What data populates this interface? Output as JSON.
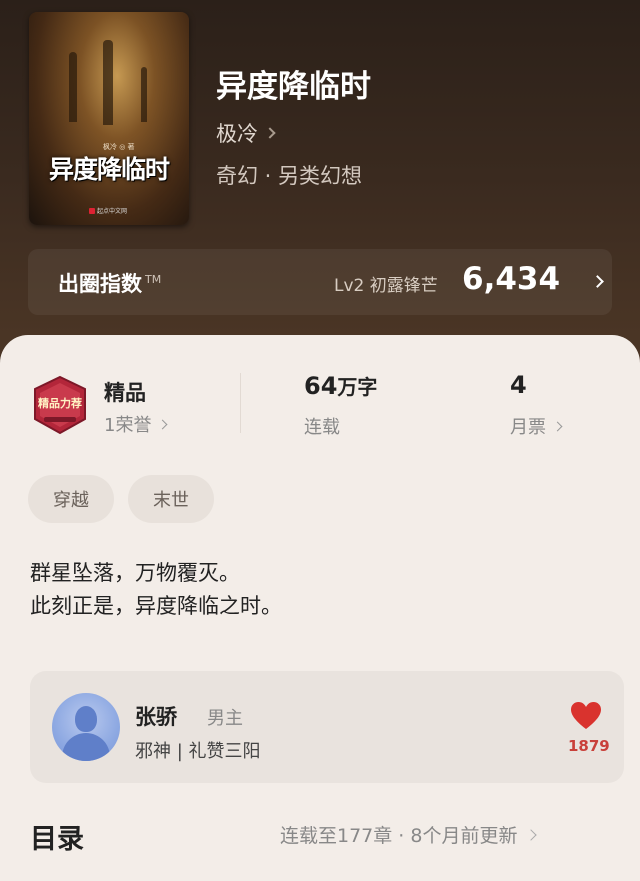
{
  "book": {
    "cover_author": "枫冷 ◎ 著",
    "cover_title": "异度降临时",
    "cover_publisher": "起点中文网",
    "title": "异度降临时",
    "author": "极冷",
    "genre": "奇幻 · 另类幻想"
  },
  "index": {
    "label": "出圈指数",
    "tm": "TM",
    "level": "Lv2 初露锋芒",
    "value": "6,434"
  },
  "stats": {
    "honor_badge_text": "精品力荐",
    "honor_name": "精品",
    "honor_count": "1荣誉",
    "words_value": "64",
    "words_unit": "万字",
    "words_status": "连载",
    "tickets_value": "4",
    "tickets_label": "月票"
  },
  "tags": [
    "穿越",
    "末世"
  ],
  "description": {
    "line1": "群星坠落，万物覆灭。",
    "line2": "此刻正是，异度降临之时。"
  },
  "character": {
    "name": "张骄",
    "role": "男主",
    "desc": "邪神 | 礼赞三阳",
    "likes": "1879",
    "heart_color": "#d9332e"
  },
  "toc": {
    "title": "目录",
    "info": "连载至177章 · 8个月前更新"
  }
}
